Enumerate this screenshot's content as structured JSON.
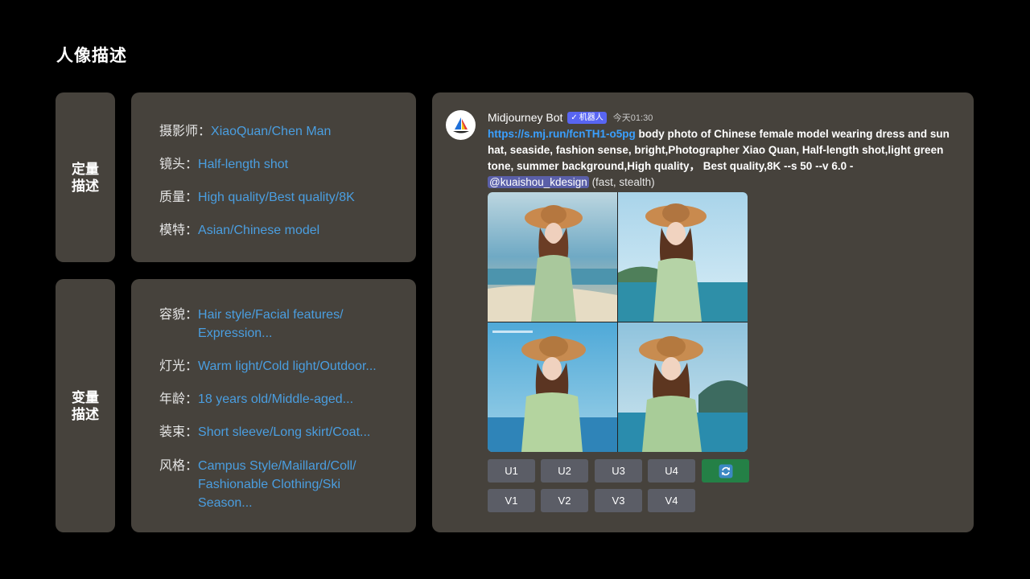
{
  "page": {
    "title": "人像描述"
  },
  "fixed_section": {
    "label_line1": "定量",
    "label_line2": "描述",
    "rows": [
      {
        "key": "摄影师：",
        "value": "XiaoQuan/Chen Man"
      },
      {
        "key": "镜头：",
        "value": "Half-length shot"
      },
      {
        "key": "质量：",
        "value": "High quality/Best quality/8K"
      },
      {
        "key": "模特：",
        "value": "Asian/Chinese model"
      }
    ]
  },
  "variable_section": {
    "label_line1": "变量",
    "label_line2": "描述",
    "rows": [
      {
        "key": "容貌：",
        "value": "Hair style/Facial features/ Expression..."
      },
      {
        "key": "灯光：",
        "value": "Warm light/Cold light/Outdoor..."
      },
      {
        "key": "年龄：",
        "value": "18 years old/Middle-aged..."
      },
      {
        "key": "装束：",
        "value": "Short sleeve/Long skirt/Coat..."
      },
      {
        "key": "风格：",
        "value": "Campus Style/Maillard/Coll/ Fashionable Clothing/Ski Season..."
      }
    ]
  },
  "message": {
    "author": "Midjourney Bot",
    "badge": "机器人",
    "timestamp": "今天01:30",
    "link": "https://s.mj.run/fcnTH1-o5pg",
    "prompt": "body photo of Chinese female model wearing dress and sun hat, seaside, fashion sense, bright,Photographer Xiao Quan, Half-length shot,light green tone, summer background,High quality，  Best quality,8K --s 50 --v 6.0 -",
    "mention": "@kuaishou_kdesign",
    "meta": "(fast, stealth)"
  },
  "buttons": {
    "upscale": [
      "U1",
      "U2",
      "U3",
      "U4"
    ],
    "variation": [
      "V1",
      "V2",
      "V3",
      "V4"
    ],
    "refresh_icon": "refresh-icon"
  },
  "colors": {
    "panel": "#46423c",
    "value_text": "#4a9ee0",
    "link": "#3aa0ff",
    "badge": "#5865f2",
    "refresh_button": "#248046",
    "action_button": "#5b5d66"
  }
}
